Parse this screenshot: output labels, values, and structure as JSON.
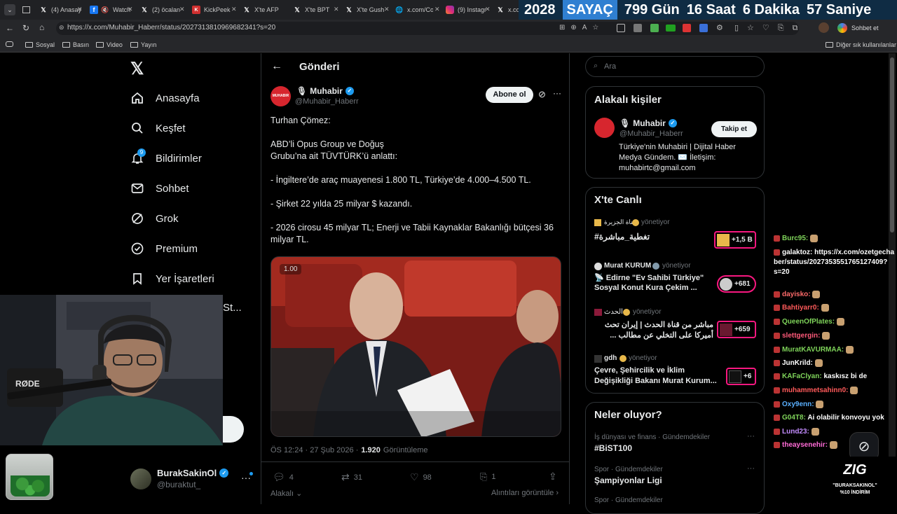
{
  "tabs": [
    {
      "label": "(4) Anasayfa",
      "icon": "x-logo-icon"
    },
    {
      "label": "f",
      "icon": "facebook-icon"
    },
    {
      "label": "Watch",
      "icon": "mute-icon"
    },
    {
      "label": "(2) öcalan",
      "icon": "x-logo-icon"
    },
    {
      "label": "KickPeek",
      "icon": "kick-icon"
    },
    {
      "label": "X'te AFP",
      "icon": "x-logo-icon"
    },
    {
      "label": "X'te BPT",
      "icon": "x-logo-icon"
    },
    {
      "label": "X'te Gush",
      "icon": "x-logo-icon"
    },
    {
      "label": "x.com/Co",
      "icon": "globe-icon"
    },
    {
      "label": "(9) Instagr",
      "icon": "instagram-icon"
    },
    {
      "label": "x.co",
      "icon": "x-logo-icon"
    }
  ],
  "counter": {
    "year": "2028",
    "label": "SAYAÇ",
    "days": "799 Gün",
    "hours": "16 Saat",
    "minutes": "6 Dakika",
    "seconds": "57 Saniye"
  },
  "address": {
    "url": "https://x.com/Muhabir_Haberr/status/2027313810969682341?s=20",
    "profile": "Sohbet et"
  },
  "bookmarks": [
    "Sosyal",
    "Basın",
    "Video",
    "Yayın"
  ],
  "bookmarks_other": "Diğer sık kullanılanlar",
  "nav": {
    "items": [
      "Anasayfa",
      "Keşfet",
      "Bildirimler",
      "Sohbet",
      "Grok",
      "Premium",
      "Yer İşaretleri",
      "St..."
    ],
    "notif_count": "9",
    "account_name": "BurakSakinOl",
    "account_handle": "@buraktut_"
  },
  "post": {
    "header": "Gönderi",
    "author": "Muhabir",
    "handle": "@Muhabir_Haberr",
    "avatar_text": "MUHABIR",
    "subscribe": "Abone ol",
    "lines": [
      "Turhan Çömez:",
      "ABD’li Opus Group ve Doğuş",
      "Grubu’na ait TÜVTÜRK’ü anlattı:",
      "- İngiltere’de araç muayenesi 1.800 TL, Türkiye’de 4.000–4.500 TL.",
      "- Şirket 22 yılda 25 milyar $ kazandı.",
      "- 2026 cirosu 45 milyar TL; Enerji ve Tabii Kaynaklar Bakanlığı bütçesi 36",
      "milyar TL."
    ],
    "video_speed": "1.00",
    "time": "ÖS 12:24 · 27 Şub 2026 ·",
    "views": "1.920",
    "views_label": "Görüntüleme",
    "replies": "4",
    "reposts": "31",
    "likes": "98",
    "bookmarks": "1",
    "related": "Alakalı",
    "quotes": "Alıntıları görüntüle"
  },
  "search": {
    "placeholder": "Ara"
  },
  "related_people": {
    "title": "Alakalı kişiler",
    "name": "Muhabir",
    "handle": "@Muhabir_Haberr",
    "follow": "Takip et",
    "bio": [
      "Türkiye'nin Muhabiri | Dijital Haber",
      "Medya Gündem. ✉️ İletişim:",
      "muhabirtc@gmail.com"
    ]
  },
  "live": {
    "title": "X'te Canlı",
    "items": [
      {
        "host": "قناة الجزيرة",
        "status": "yönetiyor",
        "title": "#تغطية_مباشرة",
        "count": "+1,5 B"
      },
      {
        "host": "Murat KURUM",
        "status": "yönetiyor",
        "title": "📡 Edirne \"Ev Sahibi Türkiye\"",
        "title2": "Sosyal Konut Kura Çekim ...",
        "count": "+681"
      },
      {
        "host": "الحدث",
        "status": "yönetiyor",
        "title": "مباشر من قناة الحدث | إيران تحث",
        "title2": "أميركا على التخلي عن مطالب ...",
        "count": "+659"
      },
      {
        "host": "gdh",
        "status": "yönetiyor",
        "title": "Çevre, Şehircilik ve İklim",
        "title2": "Değişikliği Bakanı Murat Kurum...",
        "count": "+6"
      }
    ]
  },
  "trends": {
    "title": "Neler oluyor?",
    "items": [
      {
        "category": "İş dünyası ve finans · Gündemdekiler",
        "name": "#BiST100"
      },
      {
        "category": "Spor · Gündemdekiler",
        "name": "Şampiyonlar Ligi"
      },
      {
        "category": "Spor · Gündemdekiler",
        "name": ""
      }
    ]
  },
  "chat": [
    {
      "user": "Burc95:",
      "text": "",
      "color": "#7fd45a"
    },
    {
      "user": "galaktoz:",
      "text": "https://x.com/ozetgecha",
      "color": "#ffffff"
    },
    {
      "user": "",
      "text": "ber/status/2027353551765127409?",
      "color": "#ffffff"
    },
    {
      "user": "",
      "text": "s=20",
      "color": "#ffffff"
    },
    {
      "user": "dayisko:",
      "text": "",
      "color": "#ff6b6b"
    },
    {
      "user": "Bahtiyarr0:",
      "text": "",
      "color": "#ff5a5a"
    },
    {
      "user": "QueenOfPlates:",
      "text": "",
      "color": "#7fd45a"
    },
    {
      "user": "slettgergin:",
      "text": "",
      "color": "#ff5a7a"
    },
    {
      "user": "MuratKAVURMAA:",
      "text": "",
      "color": "#7fd45a"
    },
    {
      "user": "JunKrild:",
      "text": "",
      "color": "#ffffff"
    },
    {
      "user": "KAFaClyan:",
      "text": "kaskısz bi de",
      "color": "#7fd45a"
    },
    {
      "user": "muhammetsahinn0:",
      "text": "",
      "color": "#ff5a5a"
    },
    {
      "user": "Oxy9enn:",
      "text": "",
      "color": "#5ab0ff"
    },
    {
      "user": "G04T8:",
      "text": "Ai olabilir konvoyu yok",
      "color": "#7fd45a"
    },
    {
      "user": "Lund23:",
      "text": "",
      "color": "#c38cff"
    },
    {
      "user": "theaysenehir:",
      "text": "",
      "color": "#ff6bd6"
    }
  ],
  "webcam": {
    "mic_brand": "RØDE"
  },
  "promo": {
    "brand": "ZIG",
    "code": "\"BURAKSAKINOL\"",
    "discount": "%10 İNDİRİM"
  },
  "colors": {
    "x_blue": "#1d9bf0",
    "verified": "#1d9bf0",
    "live_border": "#f91880",
    "counter_bg": "#0f2c44",
    "counter_accent": "#2f7fd1"
  }
}
